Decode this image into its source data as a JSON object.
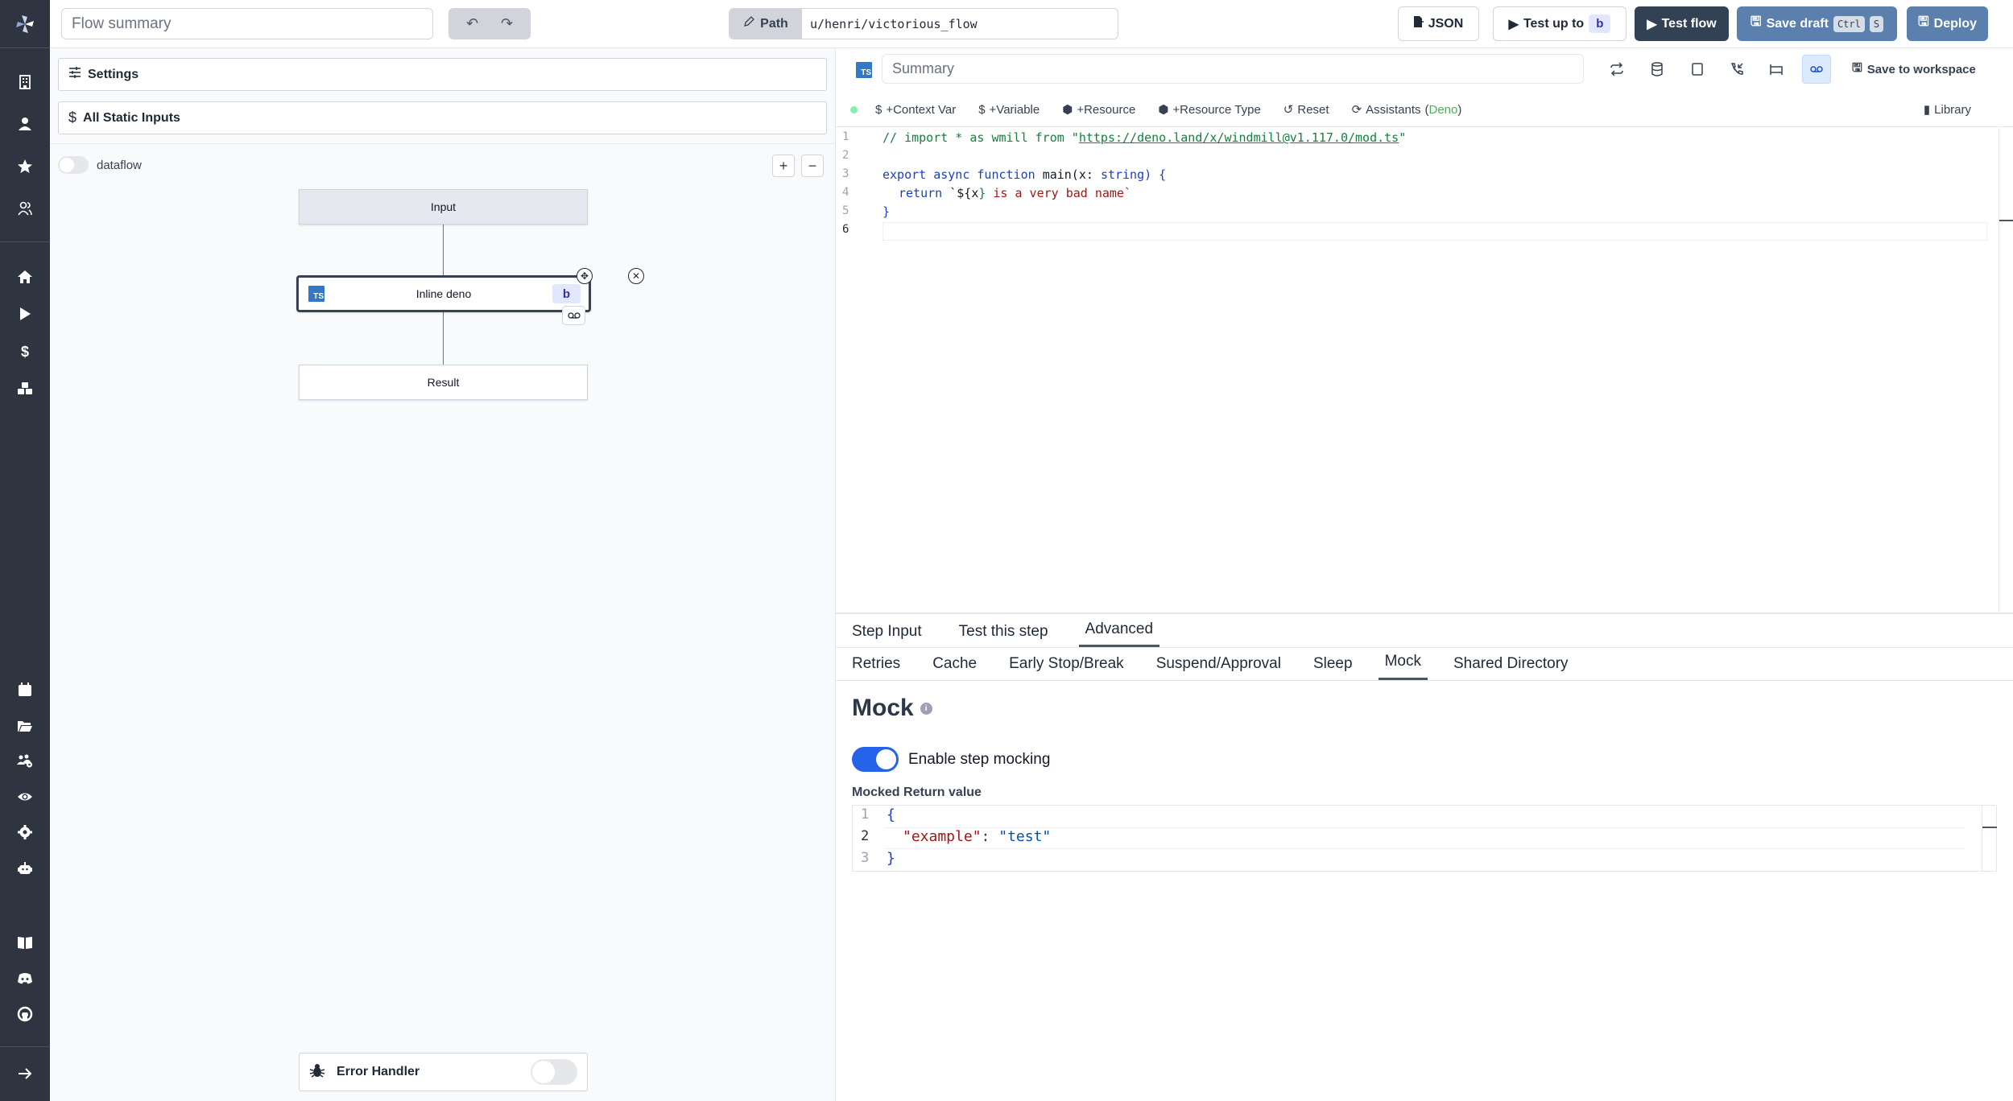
{
  "sidebar": {
    "logo": "windmill-logo",
    "top_items": [
      {
        "name": "workspace-icon",
        "label": "Workspace"
      },
      {
        "name": "user-icon",
        "label": "User"
      },
      {
        "name": "star-icon",
        "label": "Favorites"
      },
      {
        "name": "groups-icon",
        "label": "Groups"
      }
    ],
    "main_items": [
      {
        "name": "home-icon",
        "label": "Home"
      },
      {
        "name": "runs-icon",
        "label": "Runs"
      },
      {
        "name": "variables-icon",
        "label": "Variables"
      },
      {
        "name": "resources-icon",
        "label": "Resources"
      }
    ],
    "secondary_items": [
      {
        "name": "schedules-icon",
        "label": "Schedules"
      },
      {
        "name": "folders-icon",
        "label": "Folders"
      },
      {
        "name": "groups-settings-icon",
        "label": "Groups"
      },
      {
        "name": "audit-logs-icon",
        "label": "Audit logs"
      },
      {
        "name": "settings-icon",
        "label": "Settings"
      },
      {
        "name": "workers-icon",
        "label": "Workers"
      }
    ],
    "bottom_items": [
      {
        "name": "docs-icon",
        "label": "Docs"
      },
      {
        "name": "discord-icon",
        "label": "Discord"
      },
      {
        "name": "github-icon",
        "label": "GitHub"
      }
    ],
    "expand": "arrow-right-icon"
  },
  "topbar": {
    "flow_summary_placeholder": "Flow summary",
    "path_label": "Path",
    "path_value": "u/henri/victorious_flow",
    "json_label": "JSON",
    "test_up_to_label": "Test up to",
    "test_up_to_step": "b",
    "test_flow_label": "Test flow",
    "save_draft_label": "Save draft",
    "save_draft_kbd": [
      "Ctrl",
      "S"
    ],
    "deploy_label": "Deploy"
  },
  "left_panel": {
    "settings_label": "Settings",
    "static_inputs_label": "All Static Inputs",
    "dataflow_label": "dataflow",
    "dataflow_enabled": false,
    "zoom_in": "+",
    "zoom_out": "−",
    "graph": {
      "input_node": "Input",
      "step_node": {
        "label": "Inline deno",
        "id": "b",
        "language": "TS"
      },
      "result_node": "Result"
    },
    "error_handler_label": "Error Handler",
    "error_handler_enabled": false
  },
  "right_panel": {
    "language_badge": "TS",
    "summary_placeholder": "Summary",
    "save_to_workspace_label": "Save to workspace",
    "toolbar": {
      "context_var": "+Context Var",
      "variable": "+Variable",
      "resource": "+Resource",
      "resource_type": "+Resource Type",
      "reset": "Reset",
      "assistants": "Assistants",
      "assistants_lang": "Deno",
      "library": "Library"
    },
    "code": {
      "line_numbers": [
        "1",
        "2",
        "3",
        "4",
        "5",
        "6"
      ],
      "line1_comment": "// import * as wmill from \"",
      "line1_url": "https://deno.land/x/windmill@v1.117.0/mod.ts",
      "line1_end": "\"",
      "line3_kw1": "export async function ",
      "line3_fn": "main(x: ",
      "line3_type": "string",
      "line3_end": ") {",
      "line4_kw": "return ",
      "line4_tick": "`${",
      "line4_var": "x",
      "line4_close": "}",
      "line4_str": " is a very bad name",
      "line4_end": "`",
      "line5": "}"
    },
    "tabs": [
      "Step Input",
      "Test this step",
      "Advanced"
    ],
    "active_tab": "Advanced",
    "subtabs": [
      "Retries",
      "Cache",
      "Early Stop/Break",
      "Suspend/Approval",
      "Sleep",
      "Mock",
      "Shared Directory"
    ],
    "active_subtab": "Mock",
    "mock": {
      "title": "Mock",
      "toggle_label": "Enable step mocking",
      "enabled": true,
      "return_label": "Mocked Return value",
      "line_numbers": [
        "1",
        "2",
        "3"
      ],
      "open": "{",
      "key": "\"example\"",
      "colon": ": ",
      "value": "\"test\"",
      "close": "}"
    }
  },
  "colors": {
    "sidebar_bg": "#2e3440",
    "primary_dark": "#334155",
    "accent_blue": "#5b80ad",
    "toggle_on": "#2563eb",
    "ts_blue": "#3178c6"
  }
}
